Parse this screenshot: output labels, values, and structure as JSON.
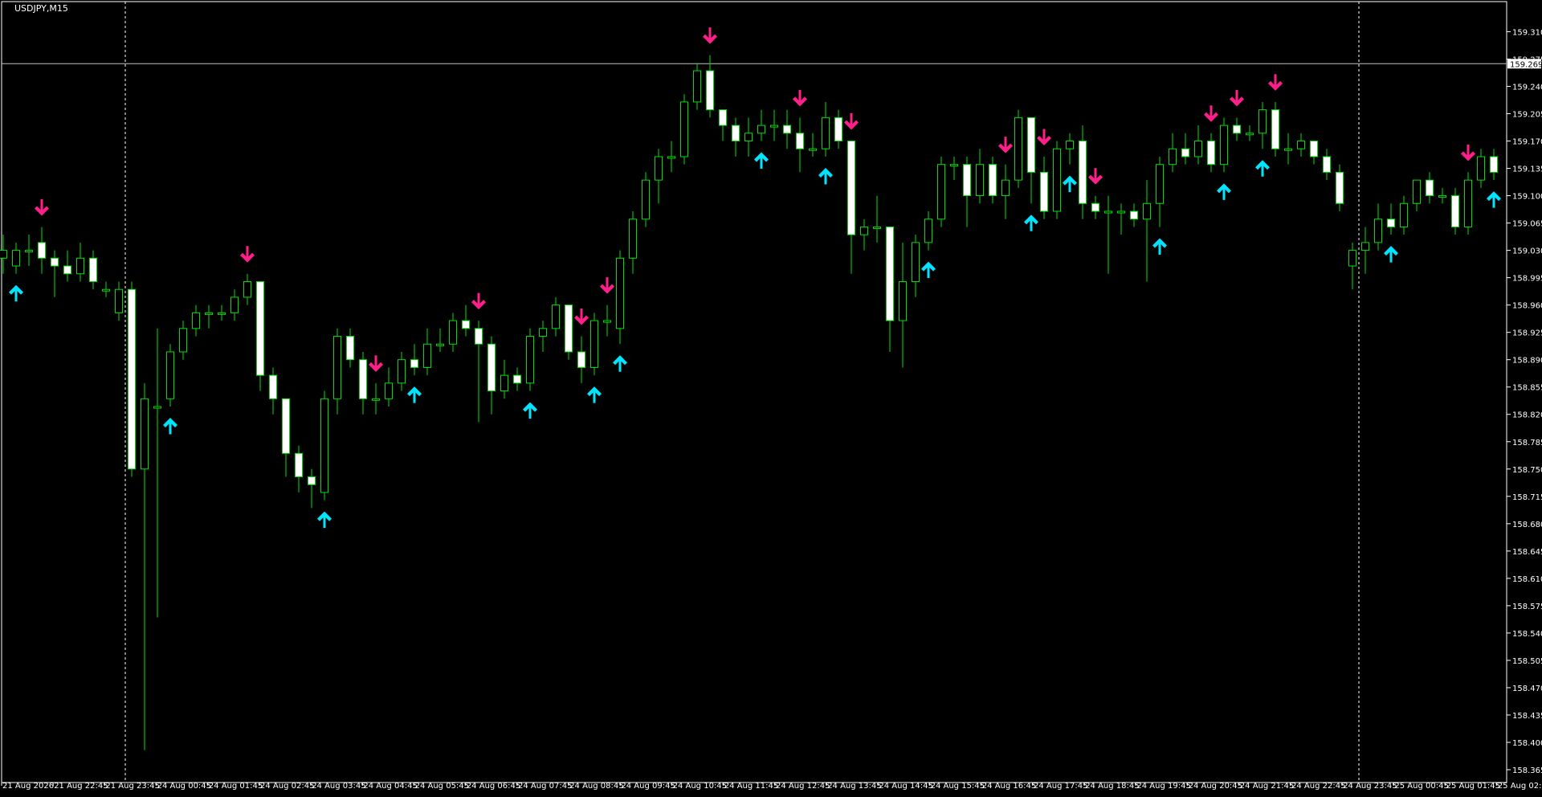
{
  "symbol_label": "USDJPY,M15",
  "colors": {
    "background": "#000000",
    "bull_outline": "#00e000",
    "bear_fill": "#ffffff",
    "wick": "#00e000",
    "axis": "#ffffff",
    "up_arrow": "#00e5ff",
    "down_arrow": "#ff1f8a",
    "separator": "#ffffff",
    "price_line": "#c0c0c0"
  },
  "chart_data": {
    "type": "candlestick",
    "title": "USDJPY,M15",
    "xlabel": "",
    "ylabel": "",
    "ylim": [
      158.365,
      159.33
    ],
    "y_ticks": [
      "159.310",
      "159.275",
      "159.240",
      "159.205",
      "159.170",
      "159.135",
      "159.100",
      "159.065",
      "159.030",
      "158.995",
      "158.960",
      "158.925",
      "158.890",
      "158.855",
      "158.820",
      "158.785",
      "158.750",
      "158.715",
      "158.680",
      "158.645",
      "158.610",
      "158.575",
      "158.540",
      "158.505",
      "158.470",
      "158.435",
      "158.400",
      "158.365"
    ],
    "x_ticks": [
      "21 Aug 2026",
      "21 Aug 22:45",
      "21 Aug 23:45",
      "24 Aug 00:45",
      "24 Aug 01:45",
      "24 Aug 02:45",
      "24 Aug 03:45",
      "24 Aug 04:45",
      "24 Aug 05:45",
      "24 Aug 06:45",
      "24 Aug 07:45",
      "24 Aug 08:45",
      "24 Aug 09:45",
      "24 Aug 10:45",
      "24 Aug 11:45",
      "24 Aug 12:45",
      "24 Aug 13:45",
      "24 Aug 14:45",
      "24 Aug 15:45",
      "24 Aug 16:45",
      "24 Aug 17:45",
      "24 Aug 18:45",
      "24 Aug 19:45",
      "24 Aug 20:45",
      "24 Aug 21:45",
      "24 Aug 22:45",
      "24 Aug 23:45",
      "25 Aug 00:45",
      "25 Aug 01:45",
      "25 Aug 02:45"
    ],
    "current_price": "159.269",
    "grid": false,
    "session_separators": [
      9,
      105
    ],
    "candles": [
      [
        159.02,
        159.03,
        159.05,
        159.0
      ],
      [
        159.01,
        159.03,
        159.04,
        159.0
      ],
      [
        159.03,
        159.03,
        159.05,
        159.01
      ],
      [
        159.04,
        159.02,
        159.06,
        159.0
      ],
      [
        159.02,
        159.01,
        159.03,
        158.97
      ],
      [
        159.01,
        159.0,
        159.03,
        158.99
      ],
      [
        159.0,
        159.02,
        159.04,
        158.99
      ],
      [
        159.02,
        158.99,
        159.03,
        158.98
      ],
      [
        158.98,
        158.98,
        158.99,
        158.97
      ],
      [
        158.95,
        158.98,
        158.99,
        158.94
      ],
      [
        158.98,
        158.75,
        158.99,
        158.74
      ],
      [
        158.75,
        158.84,
        158.86,
        158.39
      ],
      [
        158.83,
        158.83,
        158.93,
        158.56
      ],
      [
        158.84,
        158.9,
        158.91,
        158.83
      ],
      [
        158.9,
        158.93,
        158.94,
        158.89
      ],
      [
        158.93,
        158.95,
        158.96,
        158.92
      ],
      [
        158.95,
        158.95,
        158.96,
        158.93
      ],
      [
        158.95,
        158.95,
        158.96,
        158.94
      ],
      [
        158.95,
        158.97,
        158.98,
        158.94
      ],
      [
        158.97,
        158.99,
        159.0,
        158.96
      ],
      [
        158.99,
        158.87,
        158.99,
        158.85
      ],
      [
        158.87,
        158.84,
        158.88,
        158.82
      ],
      [
        158.84,
        158.77,
        158.84,
        158.74
      ],
      [
        158.77,
        158.74,
        158.78,
        158.72
      ],
      [
        158.74,
        158.73,
        158.75,
        158.7
      ],
      [
        158.72,
        158.84,
        158.85,
        158.71
      ],
      [
        158.84,
        158.92,
        158.93,
        158.82
      ],
      [
        158.92,
        158.89,
        158.93,
        158.88
      ],
      [
        158.89,
        158.84,
        158.9,
        158.82
      ],
      [
        158.84,
        158.84,
        158.86,
        158.82
      ],
      [
        158.84,
        158.86,
        158.88,
        158.83
      ],
      [
        158.86,
        158.89,
        158.9,
        158.85
      ],
      [
        158.89,
        158.88,
        158.91,
        158.87
      ],
      [
        158.88,
        158.91,
        158.93,
        158.87
      ],
      [
        158.91,
        158.91,
        158.93,
        158.9
      ],
      [
        158.91,
        158.94,
        158.95,
        158.9
      ],
      [
        158.94,
        158.93,
        158.96,
        158.92
      ],
      [
        158.93,
        158.91,
        158.94,
        158.81
      ],
      [
        158.91,
        158.85,
        158.92,
        158.82
      ],
      [
        158.85,
        158.87,
        158.89,
        158.84
      ],
      [
        158.87,
        158.86,
        158.88,
        158.85
      ],
      [
        158.86,
        158.92,
        158.93,
        158.85
      ],
      [
        158.92,
        158.93,
        158.94,
        158.9
      ],
      [
        158.93,
        158.96,
        158.97,
        158.92
      ],
      [
        158.96,
        158.9,
        158.96,
        158.89
      ],
      [
        158.9,
        158.88,
        158.92,
        158.86
      ],
      [
        158.88,
        158.94,
        158.95,
        158.87
      ],
      [
        158.94,
        158.94,
        158.96,
        158.92
      ],
      [
        158.93,
        159.02,
        159.03,
        158.91
      ],
      [
        159.02,
        159.07,
        159.08,
        159.0
      ],
      [
        159.07,
        159.12,
        159.13,
        159.06
      ],
      [
        159.12,
        159.15,
        159.16,
        159.09
      ],
      [
        159.15,
        159.15,
        159.17,
        159.13
      ],
      [
        159.15,
        159.22,
        159.23,
        159.14
      ],
      [
        159.22,
        159.26,
        159.27,
        159.21
      ],
      [
        159.26,
        159.21,
        159.28,
        159.2
      ],
      [
        159.21,
        159.19,
        159.21,
        159.17
      ],
      [
        159.19,
        159.17,
        159.2,
        159.15
      ],
      [
        159.17,
        159.18,
        159.2,
        159.15
      ],
      [
        159.18,
        159.19,
        159.21,
        159.17
      ],
      [
        159.19,
        159.19,
        159.21,
        159.17
      ],
      [
        159.19,
        159.18,
        159.21,
        159.16
      ],
      [
        159.18,
        159.16,
        159.2,
        159.13
      ],
      [
        159.16,
        159.16,
        159.18,
        159.15
      ],
      [
        159.16,
        159.2,
        159.22,
        159.15
      ],
      [
        159.2,
        159.17,
        159.21,
        159.16
      ],
      [
        159.17,
        159.05,
        159.17,
        159.0
      ],
      [
        159.05,
        159.06,
        159.07,
        159.03
      ],
      [
        159.06,
        159.06,
        159.1,
        159.04
      ],
      [
        159.06,
        158.94,
        159.06,
        158.9
      ],
      [
        158.94,
        158.99,
        159.04,
        158.88
      ],
      [
        158.99,
        159.04,
        159.05,
        158.97
      ],
      [
        159.04,
        159.07,
        159.08,
        159.03
      ],
      [
        159.07,
        159.14,
        159.15,
        159.06
      ],
      [
        159.14,
        159.14,
        159.15,
        159.12
      ],
      [
        159.14,
        159.1,
        159.15,
        159.06
      ],
      [
        159.1,
        159.14,
        159.16,
        159.09
      ],
      [
        159.14,
        159.1,
        159.15,
        159.09
      ],
      [
        159.1,
        159.12,
        159.14,
        159.07
      ],
      [
        159.12,
        159.2,
        159.21,
        159.11
      ],
      [
        159.2,
        159.13,
        159.2,
        159.09
      ],
      [
        159.13,
        159.08,
        159.15,
        159.07
      ],
      [
        159.08,
        159.16,
        159.17,
        159.07
      ],
      [
        159.16,
        159.17,
        159.18,
        159.14
      ],
      [
        159.17,
        159.09,
        159.19,
        159.07
      ],
      [
        159.09,
        159.08,
        159.1,
        159.07
      ],
      [
        159.08,
        159.08,
        159.1,
        159.0
      ],
      [
        159.08,
        159.08,
        159.09,
        159.05
      ],
      [
        159.08,
        159.07,
        159.09,
        159.06
      ],
      [
        159.07,
        159.09,
        159.12,
        158.99
      ],
      [
        159.09,
        159.14,
        159.15,
        159.06
      ],
      [
        159.14,
        159.16,
        159.18,
        159.13
      ],
      [
        159.16,
        159.15,
        159.18,
        159.14
      ],
      [
        159.15,
        159.17,
        159.19,
        159.14
      ],
      [
        159.17,
        159.14,
        159.18,
        159.13
      ],
      [
        159.14,
        159.19,
        159.2,
        159.13
      ],
      [
        159.19,
        159.18,
        159.2,
        159.17
      ],
      [
        159.18,
        159.18,
        159.19,
        159.17
      ],
      [
        159.18,
        159.21,
        159.22,
        159.16
      ],
      [
        159.21,
        159.16,
        159.22,
        159.15
      ],
      [
        159.16,
        159.16,
        159.18,
        159.14
      ],
      [
        159.16,
        159.17,
        159.18,
        159.15
      ],
      [
        159.17,
        159.15,
        159.17,
        159.14
      ],
      [
        159.15,
        159.13,
        159.16,
        159.12
      ],
      [
        159.13,
        159.09,
        159.14,
        159.08
      ],
      [
        159.01,
        159.03,
        159.04,
        158.98
      ],
      [
        159.03,
        159.04,
        159.06,
        159.0
      ],
      [
        159.04,
        159.07,
        159.09,
        159.03
      ],
      [
        159.07,
        159.06,
        159.09,
        159.05
      ],
      [
        159.06,
        159.09,
        159.1,
        159.05
      ],
      [
        159.09,
        159.12,
        159.12,
        159.08
      ],
      [
        159.12,
        159.1,
        159.13,
        159.09
      ],
      [
        159.1,
        159.1,
        159.11,
        159.09
      ],
      [
        159.1,
        159.06,
        159.11,
        159.05
      ],
      [
        159.06,
        159.12,
        159.13,
        159.05
      ],
      [
        159.12,
        159.15,
        159.16,
        159.11
      ],
      [
        159.15,
        159.13,
        159.16,
        159.12
      ]
    ],
    "up_arrows": [
      1,
      13,
      25,
      32,
      41,
      46,
      48,
      59,
      64,
      72,
      80,
      83,
      90,
      95,
      98,
      108,
      116
    ],
    "down_arrows": [
      3,
      19,
      29,
      37,
      45,
      47,
      55,
      62,
      66,
      78,
      81,
      85,
      94,
      96,
      99,
      114
    ]
  }
}
